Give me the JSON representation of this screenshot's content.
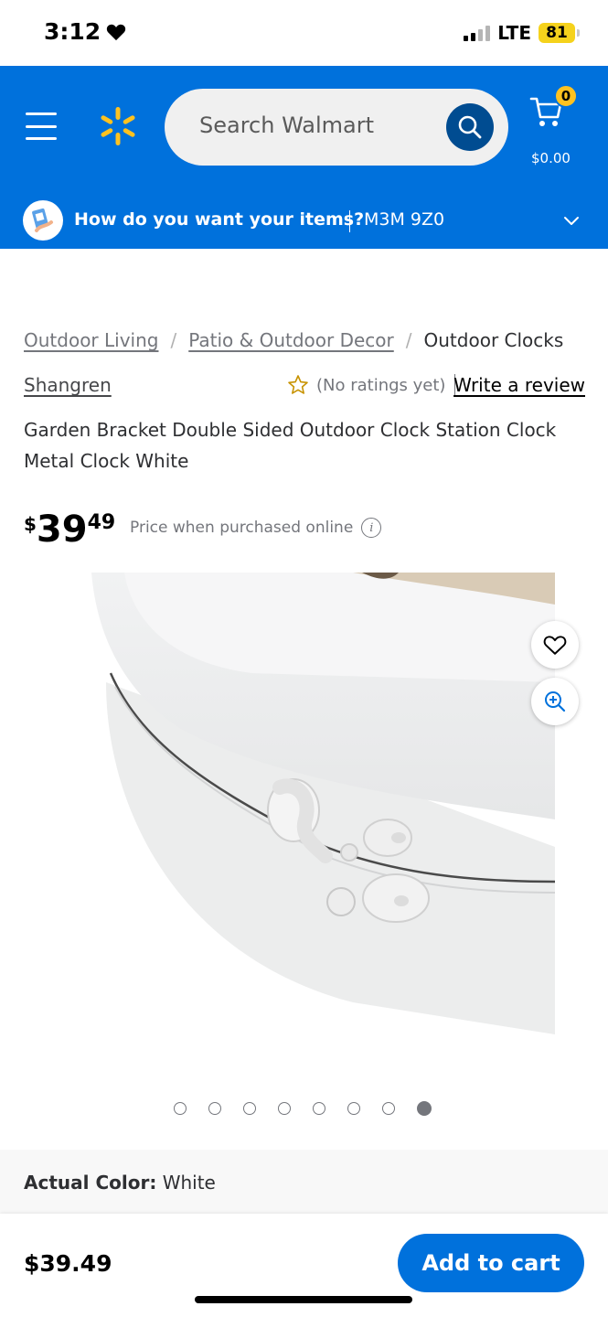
{
  "status_bar": {
    "time": "3:12",
    "network": "LTE",
    "battery": "81"
  },
  "header": {
    "search_placeholder": "Search Walmart",
    "cart_count": "0",
    "cart_total": "$0.00",
    "delivery_question": "How do you want your items?",
    "delivery_zip": "M3M 9Z0"
  },
  "breadcrumb": [
    "Outdoor Living",
    "Patio & Outdoor Decor",
    "Outdoor Clocks"
  ],
  "product": {
    "brand": "Shangren",
    "rating_text": "(No ratings yet)",
    "write_review": "Write a review",
    "title": "Garden Bracket Double Sided Outdoor Clock Station Clock Metal Clock White",
    "price_dollar": "$",
    "price_whole": "39",
    "price_cents": "49",
    "price_note": "Price when purchased online",
    "image_count": 8,
    "active_image": 8,
    "color_label": "Actual Color:",
    "color_value": "White"
  },
  "bottom_bar": {
    "price": "$39.49",
    "add_to_cart": "Add to cart"
  },
  "colors": {
    "brand_blue": "#0071dc",
    "spark_yellow": "#ffc220",
    "dark_blue": "#004c91"
  }
}
